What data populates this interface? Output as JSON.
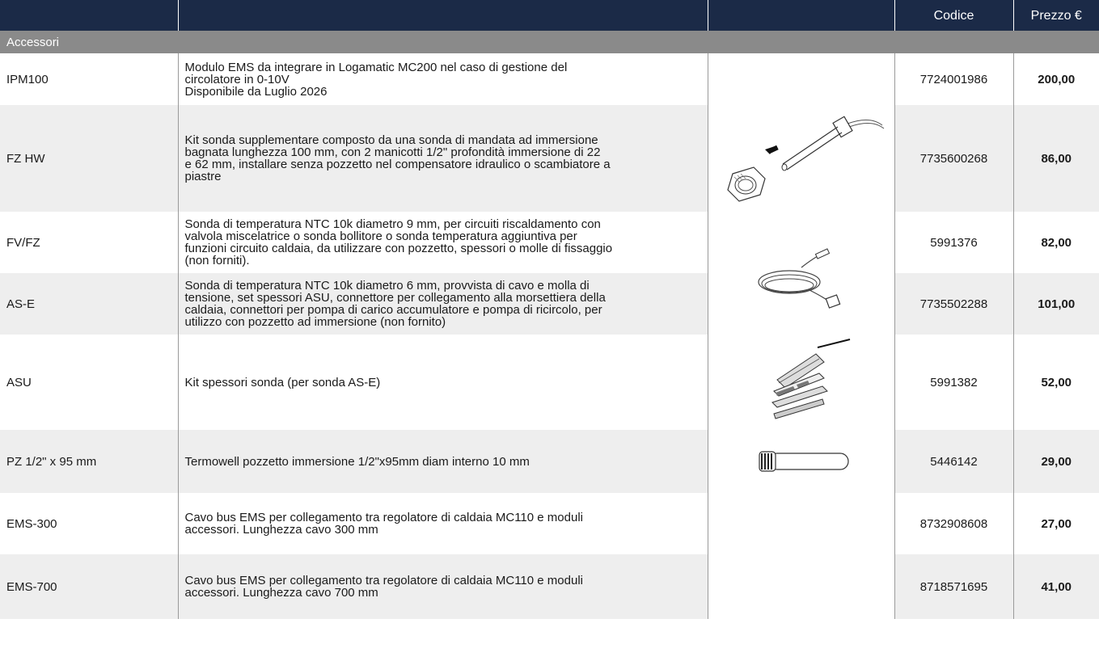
{
  "header": {
    "col1": "",
    "col2": "",
    "col3": "",
    "code": "Codice",
    "price": "Prezzo €"
  },
  "category": "Accessori",
  "rows": [
    {
      "name": "IPM100",
      "desc_lines": [
        "Modulo EMS da integrare in Logamatic MC200 nel caso di gestione del",
        "circolatore in 0-10V",
        "Disponibile da Luglio 2026"
      ],
      "code": "7724001986",
      "price": "200,00"
    },
    {
      "name": "FZ HW",
      "desc_lines": [
        "Kit sonda supplementare composto da una sonda di mandata ad immersione",
        "bagnata lunghezza 100 mm, con 2 manicotti 1/2\" profondità immersione di 22",
        "e 62 mm, installare senza pozzetto nel compensatore idraulico o scambiatore a",
        "piastre"
      ],
      "code": "7735600268",
      "price": "86,00",
      "icon": "immersion-probe-image"
    },
    {
      "name": "FV/FZ",
      "desc_lines": [
        "Sonda di temperatura NTC 10k diametro 9 mm, per circuiti riscaldamento con",
        "valvola miscelatrice o sonda bollitore o sonda temperatura aggiuntiva per",
        "funzioni circuito caldaia, da utilizzare con pozzetto, spessori o molle di fissaggio",
        "(non forniti)."
      ],
      "code": "5991376",
      "price": "82,00",
      "icon": "cable-sensor-image"
    },
    {
      "name": "AS-E",
      "desc_lines": [
        "Sonda di temperatura NTC 10k diametro 6 mm, provvista di cavo e molla di",
        "tensione, set spessori ASU, connettore per collegamento alla morsettiera della",
        "caldaia, connettori per pompa di carico accumulatore e pompa di ricircolo, per",
        "utilizzo con pozzetto ad immersione (non fornito)"
      ],
      "code": "7735502288",
      "price": "101,00"
    },
    {
      "name": "ASU",
      "desc_lines": [
        "Kit spessori sonda (per sonda AS-E)"
      ],
      "code": "5991382",
      "price": "52,00",
      "icon": "sensor-shims-image"
    },
    {
      "name": "PZ 1/2\" x 95 mm",
      "desc_lines": [
        "Termowell pozzetto immersione 1/2\"x95mm diam interno 10 mm"
      ],
      "code": "5446142",
      "price": "29,00",
      "icon": "thermowell-image"
    },
    {
      "name": "EMS-300",
      "desc_lines": [
        "Cavo bus EMS per collegamento tra regolatore di caldaia MC110 e moduli",
        "accessori. Lunghezza cavo 300 mm"
      ],
      "code": "8732908608",
      "price": "27,00"
    },
    {
      "name": "EMS-700",
      "desc_lines": [
        "Cavo bus EMS per collegamento tra regolatore di caldaia MC110 e moduli",
        "accessori. Lunghezza cavo 700 mm"
      ],
      "code": "8718571695",
      "price": "41,00"
    }
  ]
}
